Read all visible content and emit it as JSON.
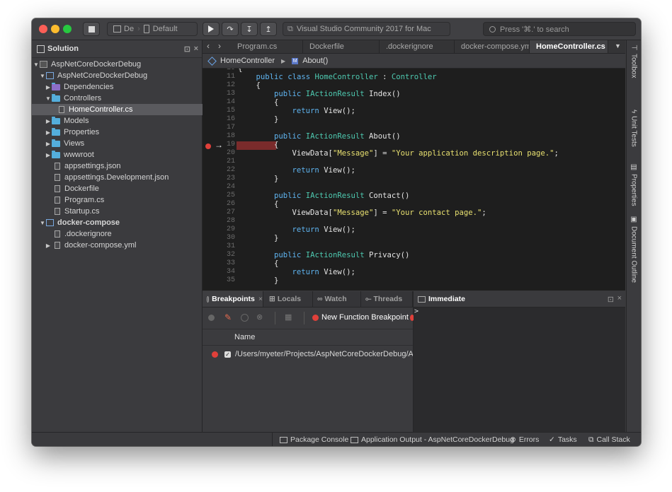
{
  "toolbar": {
    "config_label": "De",
    "device_label": "Default",
    "status_label": "Visual Studio Community 2017 for Mac",
    "search_placeholder": "Press '⌘.' to search"
  },
  "sidebar": {
    "title": "Solution",
    "items": [
      {
        "label": "AspNetCoreDockerDebug"
      },
      {
        "label": "AspNetCoreDockerDebug"
      },
      {
        "label": "Dependencies"
      },
      {
        "label": "Controllers"
      },
      {
        "label": "HomeController.cs"
      },
      {
        "label": "Models"
      },
      {
        "label": "Properties"
      },
      {
        "label": "Views"
      },
      {
        "label": "wwwroot"
      },
      {
        "label": "appsettings.json"
      },
      {
        "label": "appsettings.Development.json"
      },
      {
        "label": "Dockerfile"
      },
      {
        "label": "Program.cs"
      },
      {
        "label": "Startup.cs"
      },
      {
        "label": "docker-compose"
      },
      {
        "label": ".dockerignore"
      },
      {
        "label": "docker-compose.yml"
      }
    ]
  },
  "tabs": [
    {
      "label": "Program.cs"
    },
    {
      "label": "Dockerfile"
    },
    {
      "label": ".dockerignore"
    },
    {
      "label": "docker-compose.yml"
    },
    {
      "label": "HomeController.cs"
    }
  ],
  "breadcrumb": {
    "class": "HomeController",
    "method": "About()"
  },
  "editor": {
    "lines": [
      {
        "n": "10",
        "t": "{"
      },
      {
        "n": "11",
        "t": "    public class HomeController : Controller"
      },
      {
        "n": "12",
        "t": "    {"
      },
      {
        "n": "13",
        "t": "        public IActionResult Index()"
      },
      {
        "n": "14",
        "t": "        {"
      },
      {
        "n": "15",
        "t": "            return View();"
      },
      {
        "n": "16",
        "t": "        }"
      },
      {
        "n": "17",
        "t": ""
      },
      {
        "n": "18",
        "t": "        public IActionResult About()"
      },
      {
        "n": "19",
        "t": "        {"
      },
      {
        "n": "20",
        "t": "            ViewData[\"Message\"] = \"Your application description page.\";"
      },
      {
        "n": "21",
        "t": ""
      },
      {
        "n": "22",
        "t": "            return View();"
      },
      {
        "n": "23",
        "t": "        }"
      },
      {
        "n": "24",
        "t": ""
      },
      {
        "n": "25",
        "t": "        public IActionResult Contact()"
      },
      {
        "n": "26",
        "t": "        {"
      },
      {
        "n": "27",
        "t": "            ViewData[\"Message\"] = \"Your contact page.\";"
      },
      {
        "n": "28",
        "t": ""
      },
      {
        "n": "29",
        "t": "            return View();"
      },
      {
        "n": "30",
        "t": "        }"
      },
      {
        "n": "31",
        "t": ""
      },
      {
        "n": "32",
        "t": "        public IActionResult Privacy()"
      },
      {
        "n": "33",
        "t": "        {"
      },
      {
        "n": "34",
        "t": "            return View();"
      },
      {
        "n": "35",
        "t": "        }"
      }
    ]
  },
  "rail": [
    "Toolbox",
    "Unit Tests",
    "Properties",
    "Document Outline"
  ],
  "breakpoints_panel": {
    "tabs": [
      "Breakpoints",
      "Locals",
      "Watch",
      "Threads"
    ],
    "new_function_bp": "New Function Breakpoint",
    "column_name": "Name",
    "rows": [
      {
        "path": "/Users/myeter/Projects/AspNetCoreDockerDebug/AspNetCoreD"
      }
    ]
  },
  "immediate": {
    "title": "Immediate",
    "prompt": ">"
  },
  "statusbar": {
    "package_console": "Package Console",
    "app_output": "Application Output - AspNetCoreDockerDebug",
    "errors": "Errors",
    "tasks": "Tasks",
    "call_stack": "Call Stack"
  },
  "colors": {
    "keyword": "#5fb4f0",
    "type": "#4ec9b0",
    "string": "#e8e070",
    "breakpoint": "#e0403a"
  }
}
